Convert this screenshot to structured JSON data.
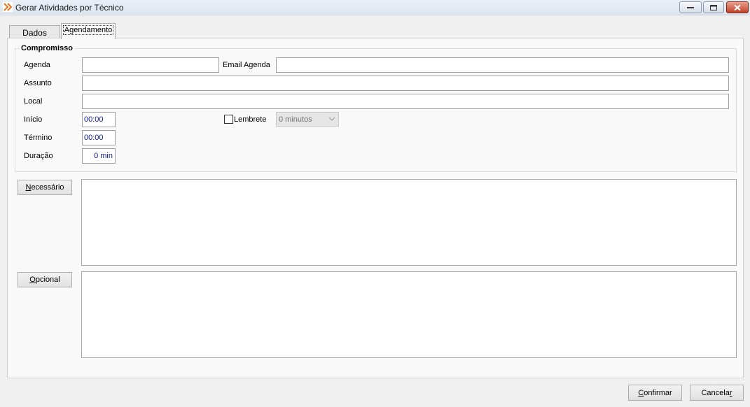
{
  "window": {
    "title": "Gerar Atividades por Técnico"
  },
  "tabs": [
    {
      "label": "Dados",
      "active": false
    },
    {
      "label": "Agendamento",
      "active": true
    }
  ],
  "compromisso": {
    "group_title": "Compromisso",
    "agenda_label": "Agenda",
    "agenda_value": "",
    "email_label": "Email Agenda",
    "email_value": "",
    "assunto_label": "Assunto",
    "assunto_value": "",
    "local_label": "Local",
    "local_value": "",
    "inicio_label": "Início",
    "inicio_value": "00:00",
    "termino_label": "Término",
    "termino_value": "00:00",
    "duracao_label": "Duração",
    "duracao_value": "0 min",
    "lembrete_label": "Lembrete",
    "lembrete_checked": false,
    "lembrete_option": "0 minutos"
  },
  "participants": {
    "necessario_prefix": "N",
    "necessario_rest": "ecessário",
    "opcional_prefix": "O",
    "opcional_rest": "pcional"
  },
  "footer": {
    "confirmar_prefix": "C",
    "confirmar_rest": "onfirmar",
    "cancelar_main": "Cancela",
    "cancelar_underlined": "r"
  },
  "colors": {
    "accent_value_text": "#0a1a8a",
    "close_button": "#c2432b"
  }
}
